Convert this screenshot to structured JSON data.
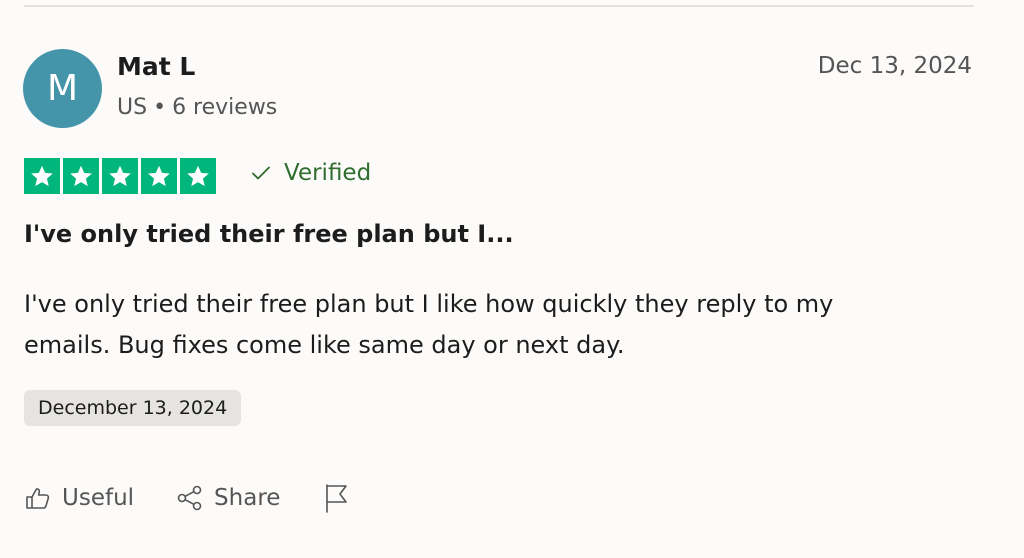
{
  "review": {
    "reviewer": {
      "avatar_initial": "M",
      "avatar_color": "#4495a9",
      "name": "Mat L",
      "country": "US",
      "separator": "•",
      "review_count": "6 reviews"
    },
    "date_posted": "Dec 13, 2024",
    "rating": {
      "value": 5,
      "max": 5,
      "star_color": "#00b67a"
    },
    "verified_label": "Verified",
    "title": "I've only tried their free plan but I...",
    "body_lines": [
      "I've only tried their free plan but I like how quickly they reply to my",
      "emails. Bug fixes come like same day or next day."
    ],
    "experience_date": "December 13, 2024"
  },
  "actions": {
    "useful_label": "Useful",
    "useful_icon": "thumbs-up-icon",
    "share_label": "Share",
    "share_icon": "share-icon",
    "report_icon": "flag-icon"
  }
}
